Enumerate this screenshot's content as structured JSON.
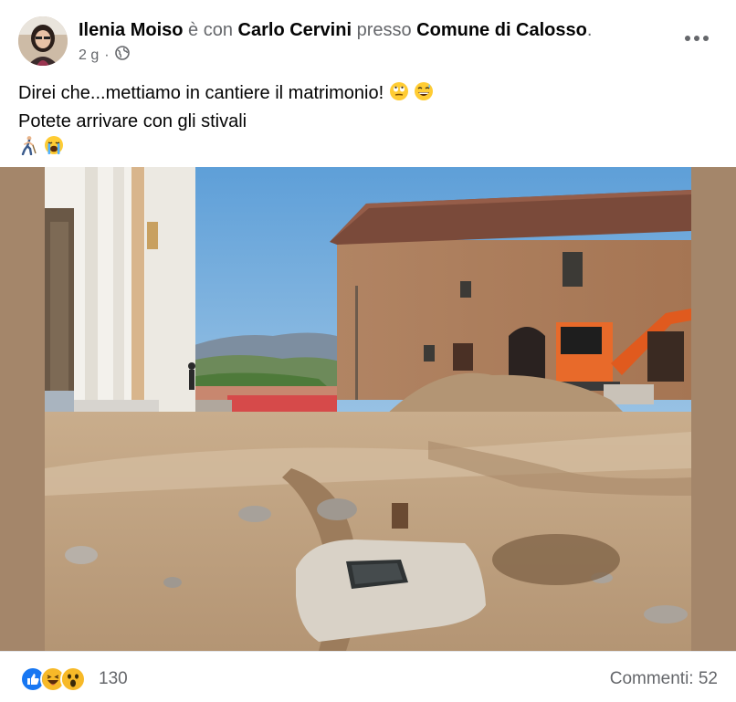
{
  "post": {
    "author": "Ilenia Moiso",
    "with_text": "è con",
    "tagged": "Carlo Cervini",
    "at_text": "presso",
    "place": "Comune di Calosso",
    "period": ".",
    "time": "2 g",
    "separator": "·",
    "privacy_icon": "globe-icon",
    "more_icon": "more-options-icon",
    "line1": "Direi che...mettiamo in cantiere il matrimonio!",
    "line1_emojis": [
      "face-with-rolling-eyes",
      "grinning-face-with-sweat"
    ],
    "line2": "Potete arrivare con gli stivali",
    "line3_emojis": [
      "person-walking",
      "loudly-crying-face"
    ]
  },
  "footer": {
    "reaction_icons": [
      "like-icon",
      "laugh-icon",
      "wow-icon"
    ],
    "reaction_count": "130",
    "comments_label": "Commenti: 52"
  },
  "colors": {
    "like_blue": "#1877f2",
    "muted_text": "#65676b",
    "photo_frame": "#a4866a"
  }
}
